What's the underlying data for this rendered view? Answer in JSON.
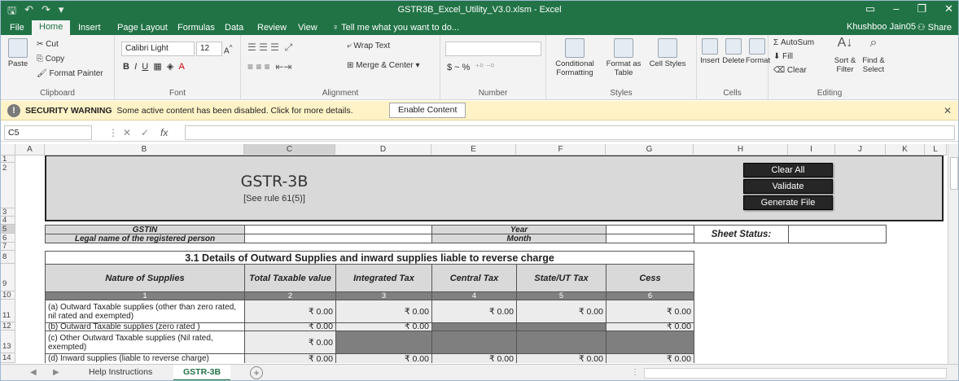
{
  "window": {
    "title": "GSTR3B_Excel_Utility_V3.0.xlsm - Excel",
    "user": "Khushboo Jain05",
    "share": "Share"
  },
  "menu": [
    "File",
    "Home",
    "Insert",
    "Page Layout",
    "Formulas",
    "Data",
    "Review",
    "View"
  ],
  "tell_me": "Tell me what you want to do...",
  "ribbon": {
    "clipboard": {
      "cut": "Cut",
      "copy": "Copy",
      "paste": "Paste",
      "format_painter": "Format Painter",
      "label": "Clipboard"
    },
    "font": {
      "name": "Calibri Light",
      "size": "12",
      "label": "Font"
    },
    "alignment": {
      "wrap": "Wrap Text",
      "merge": "Merge & Center",
      "label": "Alignment"
    },
    "number": {
      "format": "",
      "currency": "$ ~ %",
      "label": "Number"
    },
    "styles": {
      "conditional": "Conditional Formatting",
      "format_table": "Format as Table",
      "cell_styles": "Cell Styles",
      "label": "Styles"
    },
    "cells": {
      "insert": "Insert",
      "delete": "Delete",
      "format": "Format",
      "label": "Cells"
    },
    "editing": {
      "autosum": "AutoSum",
      "fill": "Fill",
      "clear": "Clear",
      "sort": "Sort & Filter",
      "find": "Find & Select",
      "label": "Editing"
    }
  },
  "security": {
    "title": "SECURITY WARNING",
    "text": "Some active content has been disabled. Click for more details.",
    "button": "Enable Content"
  },
  "formula_bar": {
    "name_box": "C5",
    "formula": ""
  },
  "columns": [
    "A",
    "B",
    "C",
    "D",
    "E",
    "F",
    "G",
    "H",
    "I",
    "J",
    "K",
    "L"
  ],
  "rows": [
    "1",
    "2",
    "3",
    "4",
    "5",
    "6",
    "7",
    "8",
    "9",
    "10",
    "11",
    "12",
    "13",
    "14"
  ],
  "form": {
    "title": "GSTR-3B",
    "subtitle": "[See rule 61(5)]",
    "buttons": [
      "Clear All",
      "Validate",
      "Generate File"
    ],
    "gstin_label": "GSTIN",
    "legal_name_label": "Legal name of the registered person",
    "year_label": "Year",
    "month_label": "Month",
    "sheet_status_label": "Sheet Status:",
    "section_title": "3.1 Details of Outward Supplies and inward supplies liable to reverse charge",
    "headers": [
      "Nature of Supplies",
      "Total Taxable value",
      "Integrated Tax",
      "Central Tax",
      "State/UT Tax",
      "Cess"
    ],
    "col_numbers": [
      "1",
      "2",
      "3",
      "4",
      "5",
      "6"
    ],
    "rows": [
      {
        "label": "(a) Outward Taxable supplies (other than zero rated, nil rated and exempted)",
        "values": [
          "₹ 0.00",
          "₹ 0.00",
          "₹ 0.00",
          "₹ 0.00",
          "₹ 0.00"
        ]
      },
      {
        "label": "(b) Outward Taxable supplies (zero rated )",
        "values": [
          "₹ 0.00",
          "₹ 0.00",
          "",
          "",
          "₹ 0.00"
        ]
      },
      {
        "label": "(c) Other Outward Taxable supplies (Nil rated, exempted)",
        "values": [
          "₹ 0.00",
          "",
          "",
          "",
          ""
        ]
      },
      {
        "label": "(d) Inward supplies (liable to reverse charge)",
        "values": [
          "₹ 0.00",
          "₹ 0.00",
          "₹ 0.00",
          "₹ 0.00",
          "₹ 0.00"
        ]
      }
    ]
  },
  "sheet_tabs": [
    "Help Instructions",
    "GSTR-3B"
  ]
}
